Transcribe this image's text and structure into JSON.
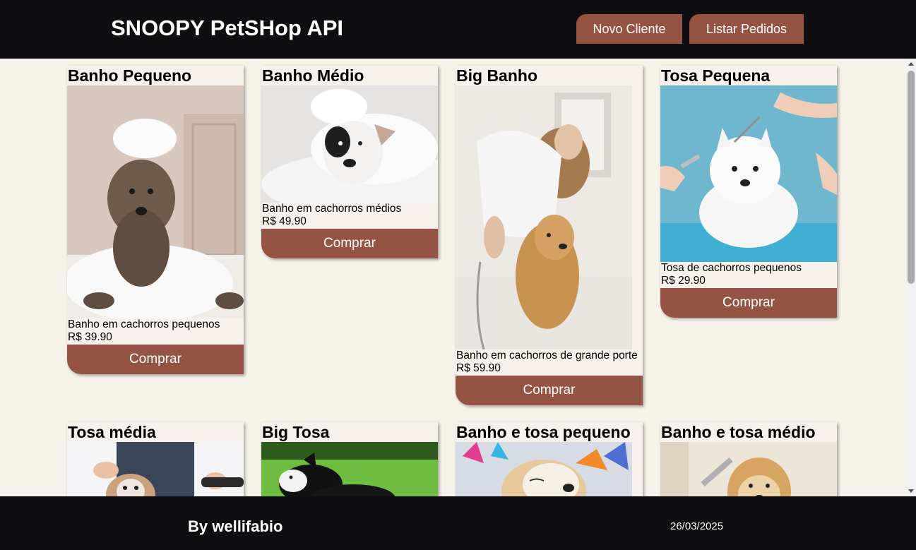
{
  "header": {
    "title": "SNOOPY PetSHop API",
    "buttons": [
      {
        "label": "Novo Cliente"
      },
      {
        "label": "Listar Pedidos"
      }
    ]
  },
  "products": [
    {
      "title": "Banho Pequeno",
      "description": "Banho em cachorros pequenos",
      "price": "R$ 39.90",
      "button": "Comprar",
      "image": "small-dog-bath-photo"
    },
    {
      "title": "Banho Médio",
      "description": "Banho em cachorros médios",
      "price": "R$ 49.90",
      "button": "Comprar",
      "image": "medium-dog-bath-photo"
    },
    {
      "title": "Big Banho",
      "description": "Banho em cachorros de grande porte",
      "price": "R$ 59.90",
      "button": "Comprar",
      "image": "big-dog-bath-photo"
    },
    {
      "title": "Tosa Pequena",
      "description": "Tosa de cachorros pequenos",
      "price": "R$ 29.90",
      "button": "Comprar",
      "image": "small-dog-grooming-photo"
    },
    {
      "title": "Tosa média",
      "image": "medium-dog-grooming-photo"
    },
    {
      "title": "Big Tosa",
      "image": "big-dog-grooming-photo"
    },
    {
      "title": "Banho e tosa pequeno",
      "image": "small-bath-and-grooming-photo"
    },
    {
      "title": "Banho e tosa médio",
      "image": "medium-bath-and-grooming-photo"
    }
  ],
  "footer": {
    "byline": "By wellifabio",
    "date": "26/03/2025"
  },
  "icons": {
    "scroll_up": "scroll-up-arrow-icon",
    "scroll_down": "scroll-down-arrow-icon"
  }
}
